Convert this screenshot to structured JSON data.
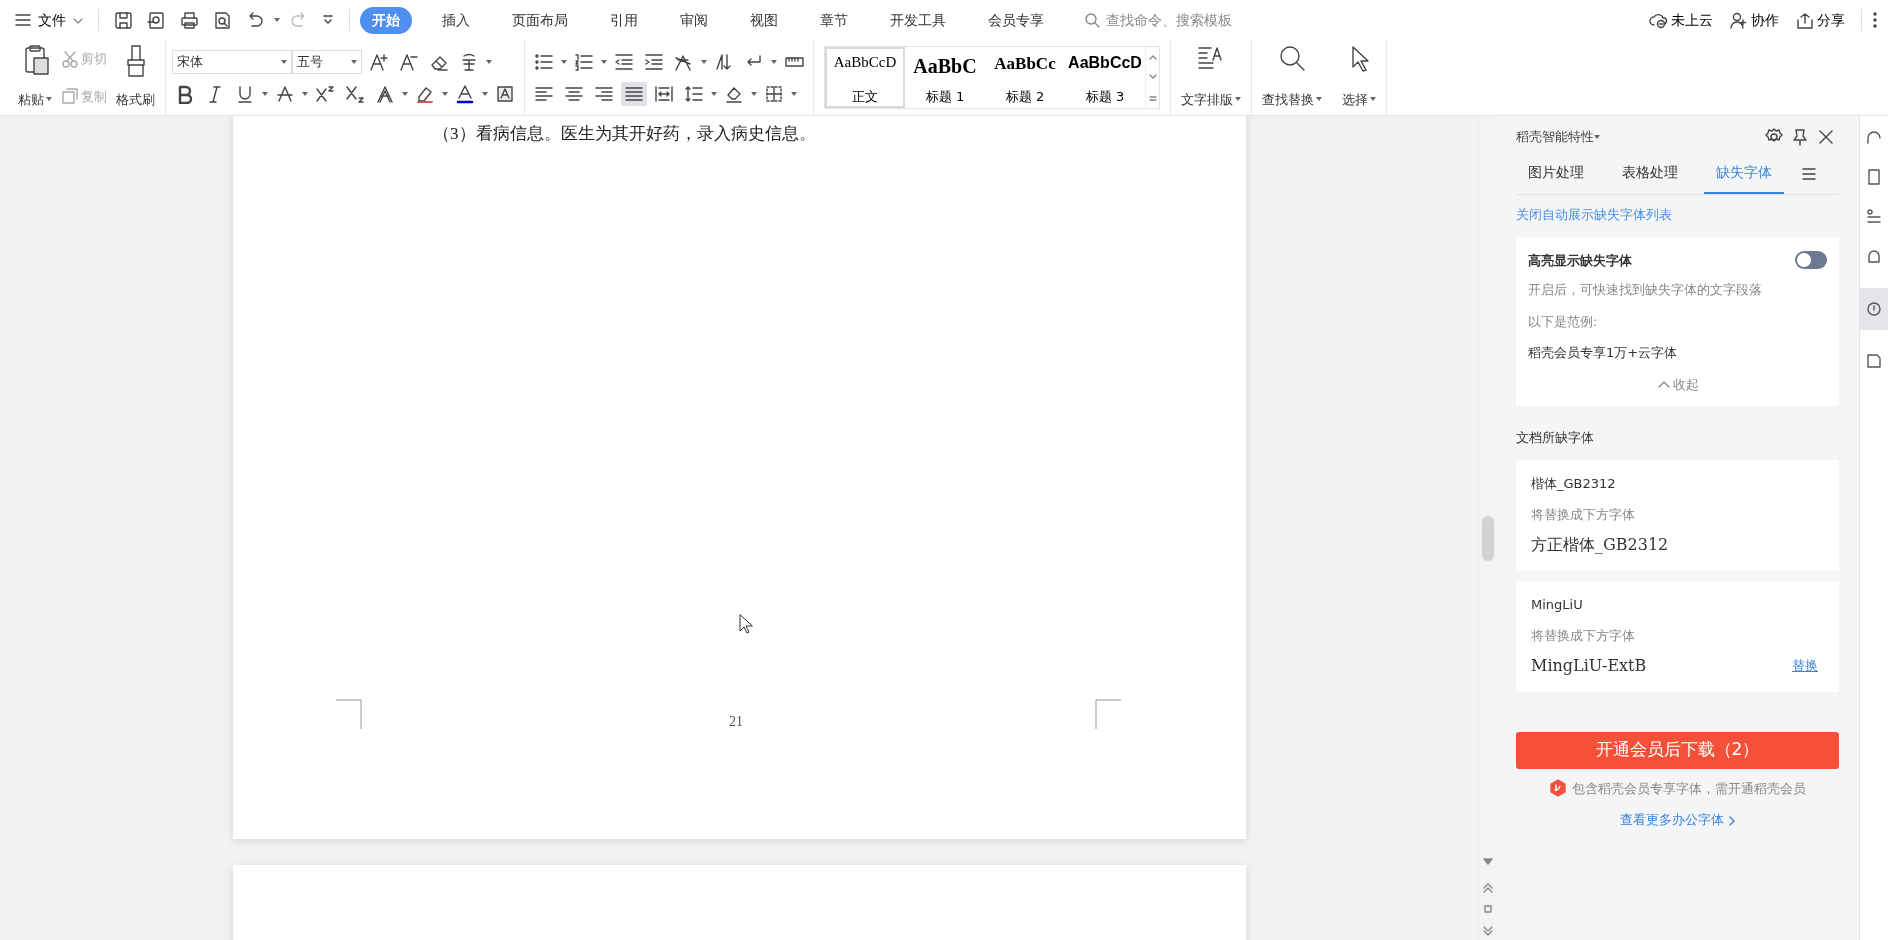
{
  "menu": {
    "label": "文件"
  },
  "tabs": [
    {
      "label": "开始",
      "selected": true
    },
    {
      "label": "插入",
      "selected": false
    },
    {
      "label": "页面布局",
      "selected": false
    },
    {
      "label": "引用",
      "selected": false
    },
    {
      "label": "审阅",
      "selected": false
    },
    {
      "label": "视图",
      "selected": false
    },
    {
      "label": "章节",
      "selected": false
    },
    {
      "label": "开发工具",
      "selected": false
    },
    {
      "label": "会员专享",
      "selected": false
    }
  ],
  "search": {
    "placeholder": "查找命令、搜索模板"
  },
  "top_actions": [
    {
      "label": "未上云"
    },
    {
      "label": "协作"
    },
    {
      "label": "分享"
    }
  ],
  "clipboard": [
    {
      "label": "粘贴",
      "kind": "large",
      "disabled": false
    },
    {
      "label": "剪切",
      "kind": "small",
      "disabled": true
    },
    {
      "label": "复制",
      "kind": "small",
      "disabled": true
    },
    {
      "label": "格式刷",
      "kind": "large",
      "disabled": false
    }
  ],
  "font": {
    "name": "宋体",
    "size": "五号"
  },
  "styles": [
    {
      "sample": "AaBbCcD",
      "label": "正文",
      "selected": true
    },
    {
      "sample": "AaBbC",
      "label": "标题 1",
      "selected": false
    },
    {
      "sample": "AaBbCc",
      "label": "标题 2",
      "selected": false
    },
    {
      "sample": "AaBbCcD",
      "label": "标题 3",
      "selected": false
    }
  ],
  "tools": [
    {
      "label": "文字排版"
    },
    {
      "label": "查找替换"
    },
    {
      "label": "选择"
    }
  ],
  "document": {
    "paragraph": "（3）看病信息。医生为其开好药，录入病史信息。",
    "page_number": "21"
  },
  "panel": {
    "title": "稻壳智能特性",
    "tabs": [
      {
        "label": "图片处理",
        "selected": false
      },
      {
        "label": "表格处理",
        "selected": false
      },
      {
        "label": "缺失字体",
        "selected": true
      }
    ],
    "link": "关闭自动展示缺失字体列表",
    "highlight": {
      "title": "高亮显示缺失字体",
      "on": false,
      "description": "开启后，可快速找到缺失字体的文字段落",
      "example_label": "以下是范例:",
      "example": "稻壳会员专享1万+云字体",
      "collapse": "收起"
    },
    "section_title": "文档所缺字体",
    "fonts": [
      {
        "name": "楷体_GB2312",
        "hint": "将替换成下方字体",
        "replacement": "方正楷体_GB2312"
      },
      {
        "name": "MingLiU",
        "hint": "将替换成下方字体",
        "replacement": "MingLiU-ExtB",
        "action": "替换"
      }
    ],
    "download_button": "开通会员后下载（2）",
    "notice": "包含稻壳会员专享字体，需开通稻壳会员",
    "more_link": "查看更多办公字体"
  }
}
